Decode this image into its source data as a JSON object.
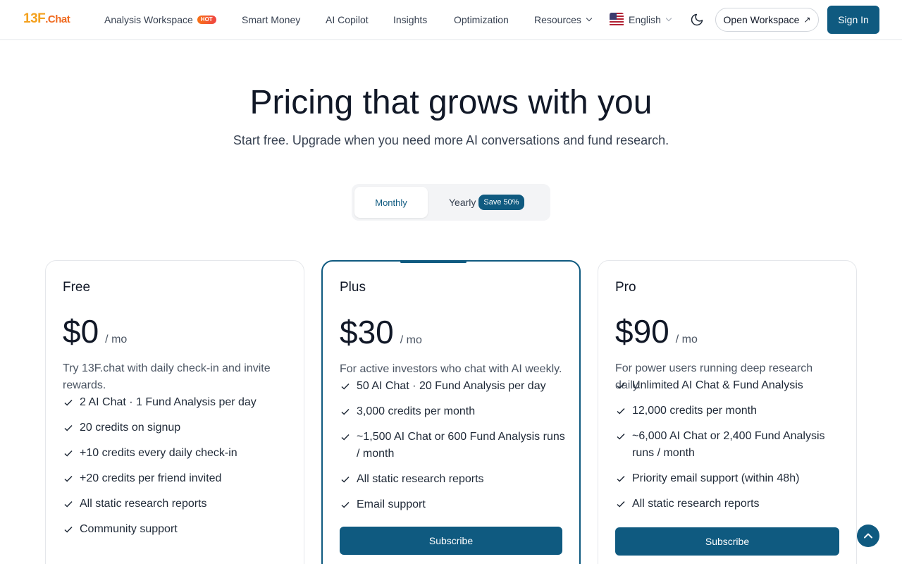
{
  "brand": {
    "logo_main": "13F",
    "logo_suffix": ".Chat"
  },
  "nav": {
    "links": [
      {
        "label": "Analysis Workspace",
        "badge": "HOT"
      },
      {
        "label": "Smart Money"
      },
      {
        "label": "AI Copilot"
      },
      {
        "label": "Insights"
      },
      {
        "label": "Optimization"
      },
      {
        "label": "Resources"
      }
    ],
    "language": "English",
    "open_workspace": "Open Workspace",
    "sign_in": "Sign In"
  },
  "hero": {
    "title": "Pricing that grows with you",
    "subtitle": "Start free. Upgrade when you need more AI conversations and fund research."
  },
  "billing_toggle": {
    "monthly": "Monthly",
    "yearly": "Yearly",
    "yearly_badge": "Save 50%",
    "selected": "Monthly"
  },
  "plans": [
    {
      "name": "Free",
      "price": "$0",
      "period": "/ mo",
      "description": "Try 13F.chat with daily check-in and invite rewards.",
      "features": [
        "2 AI Chat · 1 Fund Analysis per day",
        "20 credits on signup",
        "+10 credits every daily check-in",
        "+20 credits per friend invited",
        "All static research reports",
        "Community support"
      ]
    },
    {
      "name": "Plus",
      "price": "$30",
      "period": "/ mo",
      "description": "For active investors who chat with AI weekly.",
      "features": [
        "50 AI Chat · 20 Fund Analysis per day",
        "3,000 credits per month",
        "~1,500 AI Chat or 600 Fund Analysis runs / month",
        "All static research reports",
        "Email support"
      ],
      "cta": "Subscribe"
    },
    {
      "name": "Pro",
      "price": "$90",
      "period": "/ mo",
      "description": "For power users running deep research daily.",
      "features": [
        "Unlimited AI Chat & Fund Analysis",
        "12,000 credits per month",
        "~6,000 AI Chat or 2,400 Fund Analysis runs / month",
        "Priority email support (within 48h)",
        "All static research reports"
      ],
      "cta": "Subscribe"
    }
  ],
  "colors": {
    "accent": "#0f5a80",
    "logo_orange": "#f06a1f",
    "logo_yellow": "#f4a11e"
  }
}
